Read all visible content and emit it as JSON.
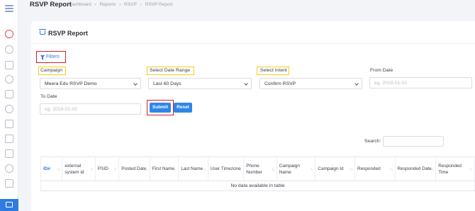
{
  "header": {
    "title": "RSVP Report",
    "breadcrumb": [
      "Dashboard",
      "›",
      "Reports",
      "›",
      "RSVP",
      "›",
      "RSVP Report"
    ]
  },
  "card": {
    "title": "RSVP Report",
    "filters_label": "Filters"
  },
  "filters": {
    "campaign": {
      "label": "Campaign",
      "value": "Meera Edu RSVP Demo"
    },
    "date_range": {
      "label": "Select Date Range",
      "value": "Last 60 Days"
    },
    "intent": {
      "label": "Select Intent",
      "value": "Confirm RSVP"
    },
    "from_date": {
      "label": "From Date",
      "placeholder": "eg. 2019-01-02"
    },
    "to_date": {
      "label": "To Date",
      "placeholder": "eg. 2019-01-02"
    },
    "submit_label": "Submit",
    "reset_label": "Reset"
  },
  "table": {
    "search_label": "Search:",
    "columns": [
      "ID#",
      "external system id",
      "PSID",
      "Posted Date",
      "First Name",
      "Last Name",
      "User Timezone",
      "Phone Number",
      "Campaign Name",
      "Campaign Id",
      "Responded",
      "Responded Date",
      "Responded Time"
    ],
    "empty_message": "No data available in table"
  },
  "colors": {
    "accent": "#2f7be0",
    "highlight_red": "#d11f2a",
    "highlight_yellow": "#f2cf1b"
  }
}
